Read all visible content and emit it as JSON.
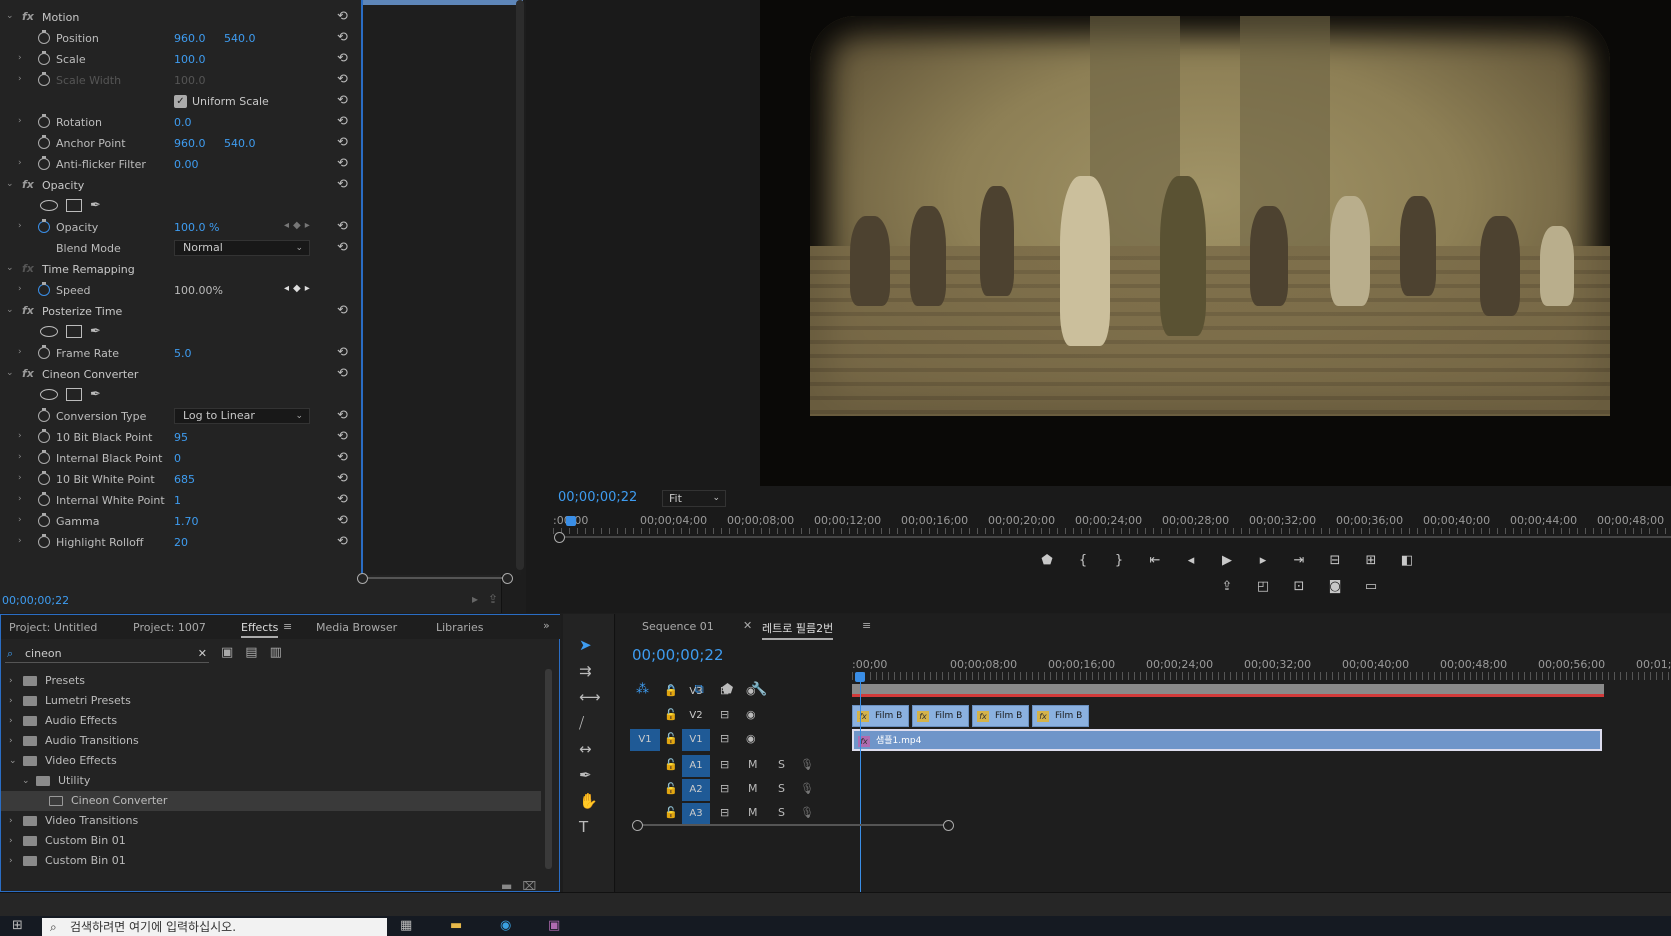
{
  "effect_controls": {
    "rows": [
      {
        "type": "section",
        "fx": "fx",
        "label": "Motion",
        "reset": true
      },
      {
        "type": "prop",
        "label": "Position",
        "v1": "960.0",
        "v2": "540.0",
        "reset": true,
        "twirl": false
      },
      {
        "type": "prop",
        "label": "Scale",
        "v1": "100.0",
        "reset": true,
        "twirl": true
      },
      {
        "type": "prop",
        "label": "Scale Width",
        "v1": "100.0",
        "reset": true,
        "twirl": true,
        "disabled": true
      },
      {
        "type": "check",
        "label": "Uniform Scale",
        "reset": true
      },
      {
        "type": "prop",
        "label": "Rotation",
        "v1": "0.0",
        "reset": true,
        "twirl": true
      },
      {
        "type": "prop",
        "label": "Anchor Point",
        "v1": "960.0",
        "v2": "540.0",
        "reset": true,
        "twirl": false
      },
      {
        "type": "prop",
        "label": "Anti-flicker Filter",
        "v1": "0.00",
        "reset": true,
        "twirl": true
      },
      {
        "type": "section",
        "fx": "fx",
        "label": "Opacity",
        "reset": true
      },
      {
        "type": "shapes"
      },
      {
        "type": "prop",
        "label": "Opacity",
        "v1": "100.0 %",
        "reset": true,
        "twirl": true,
        "blue": true,
        "kf": true
      },
      {
        "type": "select",
        "label": "Blend Mode",
        "value": "Normal",
        "reset": true
      },
      {
        "type": "section",
        "fx": "fx",
        "label": "Time Remapping",
        "dimfx": true
      },
      {
        "type": "prop",
        "label": "Speed",
        "v1": "100.00%",
        "twirl": true,
        "blue": true,
        "kf": true,
        "kfact": true,
        "grey": true
      },
      {
        "type": "section",
        "fx": "fx",
        "label": "Posterize Time",
        "reset": true
      },
      {
        "type": "shapes"
      },
      {
        "type": "prop",
        "label": "Frame Rate",
        "v1": "5.0",
        "reset": true,
        "twirl": true
      },
      {
        "type": "section",
        "fx": "fx",
        "label": "Cineon Converter",
        "reset": true
      },
      {
        "type": "shapes"
      },
      {
        "type": "select",
        "label": "Conversion Type",
        "value": "Log to Linear",
        "reset": true,
        "sw": true
      },
      {
        "type": "prop",
        "label": "10 Bit Black Point",
        "v1": "95",
        "reset": true,
        "twirl": true
      },
      {
        "type": "prop",
        "label": "Internal Black Point",
        "v1": "0",
        "reset": true,
        "twirl": true
      },
      {
        "type": "prop",
        "label": "10 Bit White Point",
        "v1": "685",
        "reset": true,
        "twirl": true
      },
      {
        "type": "prop",
        "label": "Internal White Point",
        "v1": "1",
        "reset": true,
        "twirl": true
      },
      {
        "type": "prop",
        "label": "Gamma",
        "v1": "1.70",
        "reset": true,
        "twirl": true
      },
      {
        "type": "prop",
        "label": "Highlight Rolloff",
        "v1": "20",
        "reset": true,
        "twirl": true
      }
    ],
    "timecode": "00;00;00;22"
  },
  "program_monitor": {
    "timecode": "00;00;00;22",
    "fit": "Fit",
    "ruler": [
      ":00;00",
      "00;00;04;00",
      "00;00;08;00",
      "00;00;12;00",
      "00;00;16;00",
      "00;00;20;00",
      "00;00;24;00",
      "00;00;28;00",
      "00;00;32;00",
      "00;00;36;00",
      "00;00;40;00",
      "00;00;44;00",
      "00;00;48;00"
    ]
  },
  "project": {
    "tabs": [
      "Project: Untitled",
      "Project: 1007",
      "Effects",
      "Media Browser",
      "Libraries"
    ],
    "active_tab": "Effects",
    "search": "cineon",
    "tree": [
      {
        "name": "Presets",
        "level": 0,
        "arrow": "›",
        "icon": "folder"
      },
      {
        "name": "Lumetri Presets",
        "level": 0,
        "arrow": "›",
        "icon": "folder"
      },
      {
        "name": "Audio Effects",
        "level": 0,
        "arrow": "›",
        "icon": "folder"
      },
      {
        "name": "Audio Transitions",
        "level": 0,
        "arrow": "›",
        "icon": "folder"
      },
      {
        "name": "Video Effects",
        "level": 0,
        "arrow": "⌄",
        "icon": "folder"
      },
      {
        "name": "Utility",
        "level": 1,
        "arrow": "⌄",
        "icon": "folder"
      },
      {
        "name": "Cineon Converter",
        "level": 2,
        "arrow": "",
        "icon": "fx",
        "selected": true
      },
      {
        "name": "Video Transitions",
        "level": 0,
        "arrow": "›",
        "icon": "folder"
      },
      {
        "name": "Custom Bin 01",
        "level": 0,
        "arrow": "›",
        "icon": "folder"
      },
      {
        "name": "Custom Bin 01",
        "level": 0,
        "arrow": "›",
        "icon": "folder"
      }
    ]
  },
  "timeline": {
    "tabs": [
      "Sequence 01",
      "레트로 필름2번"
    ],
    "active_tab": "레트로 필름2번",
    "timecode": "00;00;00;22",
    "ruler": [
      ":00;00",
      "00;00;08;00",
      "00;00;16;00",
      "00;00;24;00",
      "00;00;32;00",
      "00;00;40;00",
      "00;00;48;00",
      "00;00;56;00",
      "00;01;04;"
    ],
    "video_tracks": [
      "V3",
      "V2",
      "V1"
    ],
    "audio_tracks": [
      "A1",
      "A2",
      "A3"
    ],
    "source_patch": "V1",
    "v2_clips": [
      "Film B",
      "Film B",
      "Film B",
      "Film B"
    ],
    "v1_clip": "샘플1.mp4",
    "audio_m": "M",
    "audio_s": "S"
  },
  "taskbar": {
    "search_placeholder": "검색하려면 여기에 입력하십시오."
  }
}
